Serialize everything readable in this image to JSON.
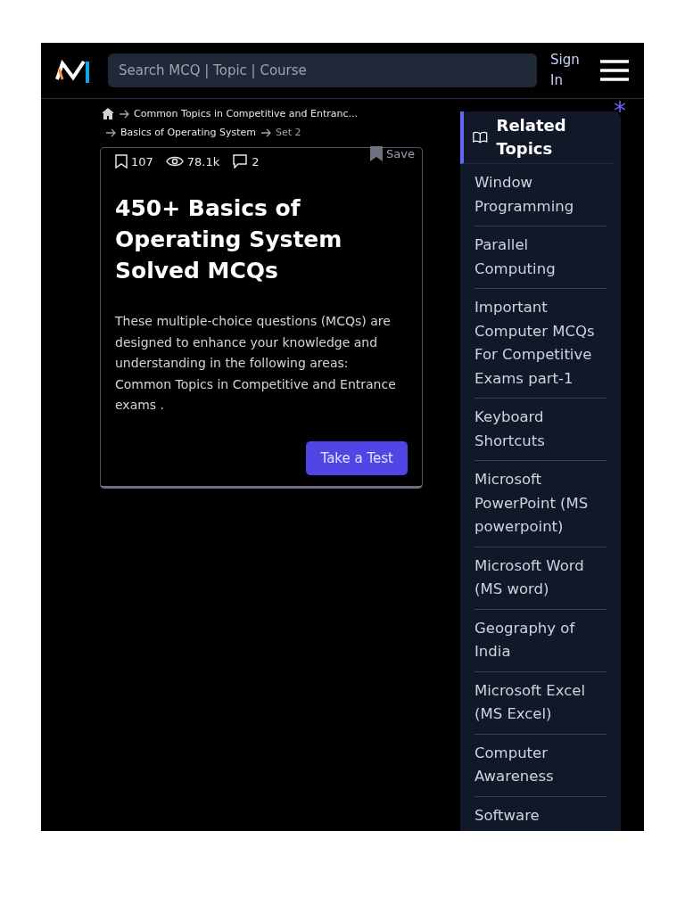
{
  "header": {
    "search": {
      "placeholder": "Search MCQ | Topic | Course"
    },
    "sign_in": "Sign In"
  },
  "breadcrumb": {
    "items": [
      "Common Topics in Competitive and Entranc...",
      "Basics of Operating System"
    ],
    "current": "Set 2"
  },
  "card": {
    "stats": {
      "bookmarks": "107",
      "views": "78.1k",
      "comments": "2"
    },
    "save": "Save",
    "title": "450+ Basics of Operating System Solved MCQs",
    "description": "These multiple-choice questions (MCQs) are designed to enhance your knowledge and understanding in the following areas: Common Topics in Competitive and Entrance exams .",
    "button": "Take a Test"
  },
  "sidebar": {
    "marker": "*",
    "title": "Related Topics",
    "items": [
      "Window Programming",
      "Parallel Computing",
      "Important Computer MCQs For Competitive Exams part-1",
      "Keyboard Shortcuts",
      "Microsoft PowerPoint (MS powerpoint)",
      "Microsoft Word (MS word)",
      "Geography of India",
      "Microsoft Excel (MS Excel)",
      "Computer Awareness",
      "Software"
    ]
  }
}
